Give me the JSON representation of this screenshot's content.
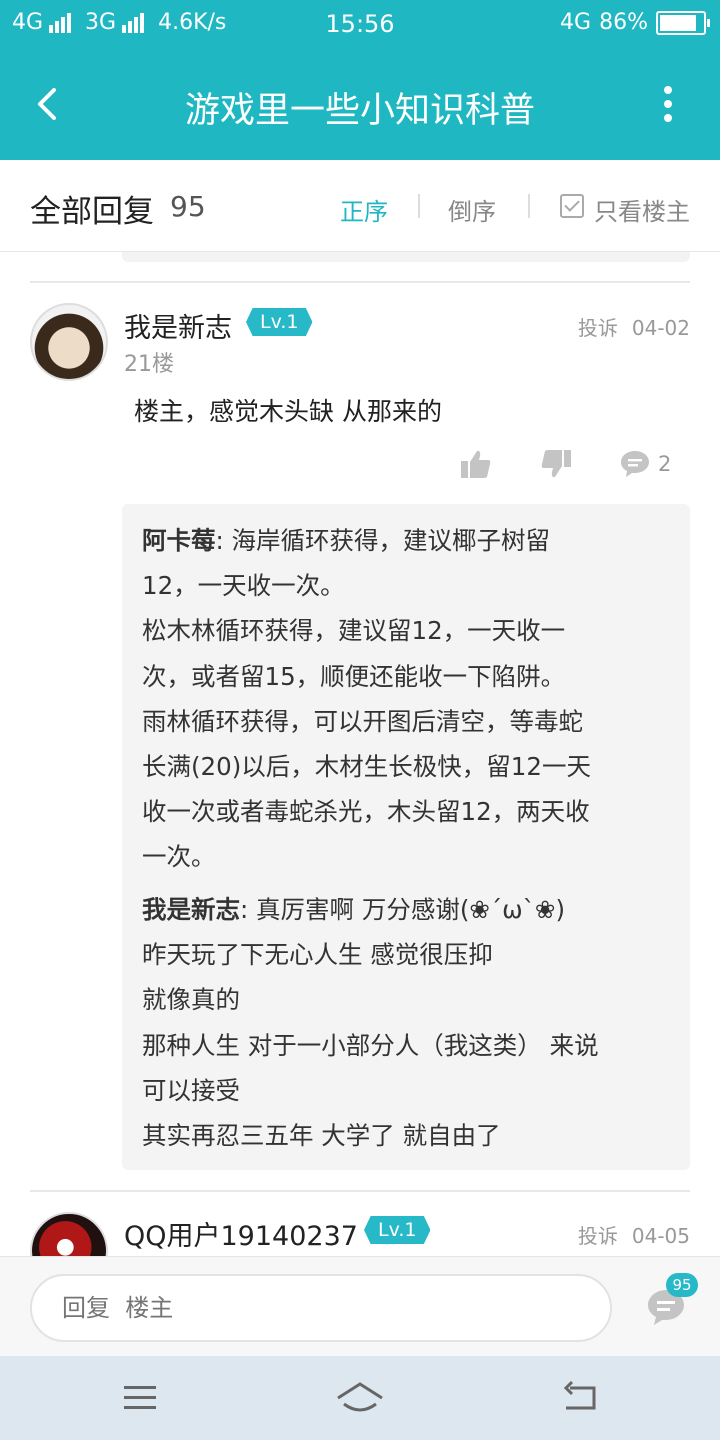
{
  "status_bar": {
    "network1": "4G",
    "network2": "3G",
    "speed": "4.6K/s",
    "time": "15:56",
    "network3": "4G",
    "battery": "86%",
    "battery_level": 0.86
  },
  "header": {
    "title": "游戏里一些小知识科普",
    "back_icon": "back-arrow-icon",
    "more_icon": "more-vertical-icon"
  },
  "sortbar": {
    "label": "全部回复",
    "count": "95",
    "asc_label": "正序",
    "desc_label": "倒序",
    "only_op_label": "只看楼主"
  },
  "post": {
    "username": "我是新志",
    "level": "Lv.1",
    "report": "投诉",
    "date": "04-02",
    "floor": "21楼",
    "content": "楼主，感觉木头缺  从那来的",
    "comment_count": "2",
    "replies": [
      {
        "nick": "阿卡莓",
        "text": ": 海岸循环获得，建议椰子树留12，一天收一次。松木林循环获得，建议留12，一天收一次，或者留15，顺便还能收一下陷阱。雨林循环获得，可以开图后清空，等毒蛇长满(20)以后，木材生长极快，留12一天收一次或者毒蛇杀光，木头留12，两天收一次。",
        "lines": [
          "12，一天收一次。",
          "松木林循环获得，建议留12，一天收一",
          "次，或者留15，顺便还能收一下陷阱。",
          "雨林循环获得，可以开图后清空，等毒蛇",
          "长满(20)以后，木材生长极快，留12一天",
          "收一次或者毒蛇杀光，木头留12，两天收",
          "一次。"
        ],
        "first_line": ": 海岸循环获得，建议椰子树留"
      },
      {
        "nick": "我是新志",
        "first_line": ": 真厉害啊  万分感谢(❀´ω`❀)",
        "lines": [
          "昨天玩了下无心人生  感觉很压抑",
          "就像真的",
          "那种人生  对于一小部分人（我这类） 来说",
          "可以接受",
          "其实再忍三五年  大学了 就自由了"
        ]
      }
    ]
  },
  "next_post": {
    "username": "QQ用户19140237",
    "level": "Lv.1",
    "report": "投诉",
    "date": "04-05"
  },
  "bottom": {
    "placeholder": "回复  楼主",
    "comment_badge": "95"
  },
  "nav": {
    "menu_icon": "menu-icon",
    "home_icon": "home-icon",
    "back_icon": "return-icon"
  }
}
